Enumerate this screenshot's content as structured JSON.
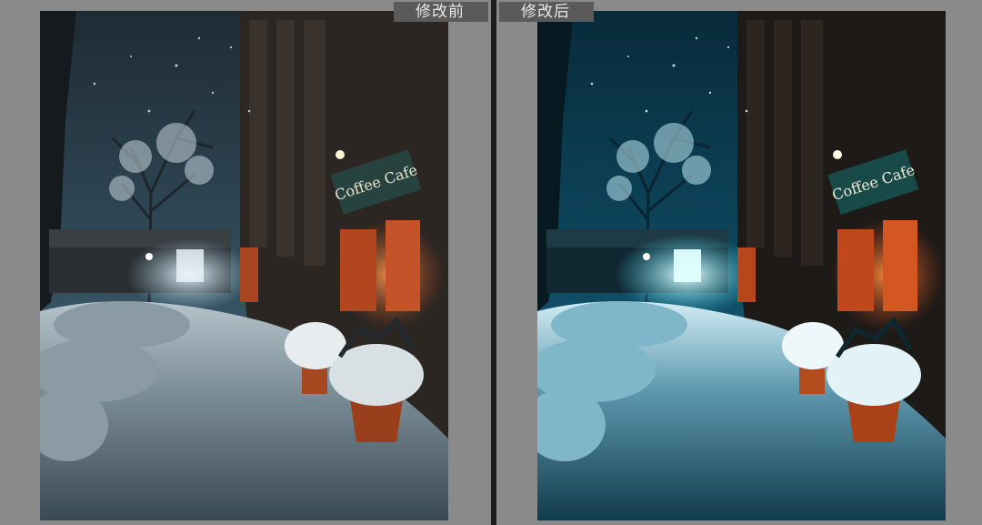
{
  "panels": {
    "before": {
      "label": "修改前"
    },
    "after": {
      "label": "修改后"
    }
  },
  "sign": {
    "text": "Coffee Cafe"
  },
  "colors": {
    "background": "#8a8a8a",
    "divider": "#1c1c1c",
    "label_bg": "#5a5a5a",
    "before_sky": "#2b3c47",
    "after_sky": "#0f4a63",
    "warm_light": "#e0622b",
    "cyan_light": "#7ff4ff"
  }
}
